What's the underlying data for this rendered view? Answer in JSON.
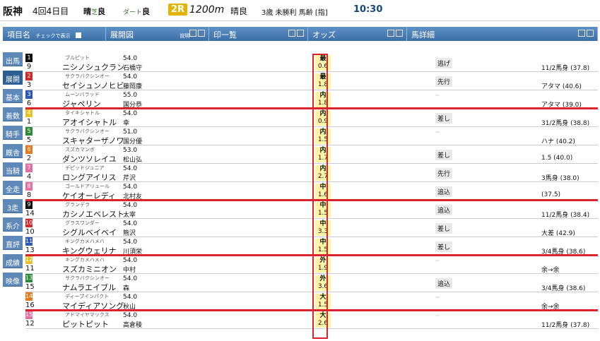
{
  "race": {
    "venue": "阪神",
    "meet": "4回4日目",
    "weather1_label": "晴",
    "weather1_turf": "芝",
    "weather1_cond": "良",
    "weather2_track": "ダート",
    "weather2_cond": "良",
    "race_no": "2R",
    "distance": "1200m",
    "weather3": "晴良",
    "conditions": "3歳 未勝利 馬齢 [指]",
    "time": "10:30"
  },
  "headers": {
    "items_label": "項目名",
    "items_check": "チェックで表示",
    "timeline": "展開図",
    "timeline_sub": "説明",
    "printlist": "印一覧",
    "odds": "オッズ",
    "horse_detail": "馬詳細"
  },
  "sidebar": {
    "items": [
      {
        "label": "出馬"
      },
      {
        "label": "展開"
      },
      {
        "label": "基本"
      },
      {
        "label": "着数"
      },
      {
        "label": "騎手"
      },
      {
        "label": "厩舎"
      },
      {
        "label": "当騎"
      },
      {
        "label": "全走"
      },
      {
        "label": "3走"
      },
      {
        "label": "系介"
      },
      {
        "label": "直評"
      },
      {
        "label": "成績"
      },
      {
        "label": "映像"
      }
    ]
  },
  "horses": [
    {
      "box": "1",
      "num": "9",
      "name": "ニシノシュクラン",
      "sire": "ブルピット",
      "weight": "54.0",
      "jockey": "石橋守",
      "odds": "0.6",
      "odds_label": "最",
      "pos": "逃げ",
      "margin": "11/2馬身 (37.8)"
    },
    {
      "box": "2",
      "num": "3",
      "name": "セイシュンノヒビ",
      "sire": "サクラバクシンオー",
      "weight": "54.0",
      "jockey": "藤岡康",
      "odds": "1.8",
      "odds_label": "最",
      "pos": "先行",
      "margin": "アタマ (40.6)"
    },
    {
      "box": "3",
      "num": "6",
      "name": "ジャペリン",
      "sire": "ムーンバラッド",
      "weight": "55.0",
      "jockey": "国分恭",
      "odds": "1.8",
      "odds_label": "内",
      "pos": "",
      "margin": "アタマ (39.0)"
    },
    {
      "box": "4",
      "num": "1",
      "name": "アオイシャトル",
      "sire": "タイキシャトル",
      "weight": "54.0",
      "jockey": "幸",
      "odds": "0.9",
      "odds_label": "内",
      "pos": "差し",
      "margin": "31/2馬身 (38.8)"
    },
    {
      "box": "5",
      "num": "5",
      "name": "スキャターザノワ",
      "sire": "サクラバクシンオー",
      "weight": "51.0",
      "jockey": "国分優",
      "odds": "1.5",
      "odds_label": "内",
      "pos": "",
      "margin": "ハナ (40.2)"
    },
    {
      "box": "6",
      "num": "2",
      "name": "ダンツソレイユ",
      "sire": "スズカマンボ",
      "weight": "53.0",
      "jockey": "松山弘",
      "odds": "1.7",
      "odds_label": "内",
      "pos": "差し",
      "margin": "1.5 (40.0)"
    },
    {
      "box": "7",
      "num": "4",
      "name": "ロングアイリス",
      "sire": "デピッドジュニア",
      "weight": "54.0",
      "jockey": "芹沢",
      "odds": "2.7",
      "odds_label": "内",
      "pos": "先行",
      "margin": "3馬身 (38.0)"
    },
    {
      "box": "8",
      "num": "8",
      "name": "ケイオーレディ",
      "sire": "ゴールドアリュール",
      "weight": "54.0",
      "jockey": "北村友",
      "odds": "1.6",
      "odds_label": "中",
      "pos": "追込",
      "margin": "(37.5)"
    },
    {
      "box": "9",
      "num": "14",
      "name": "カシノエベレスト",
      "sire": "グランデラ",
      "weight": "54.0",
      "jockey": "太宰",
      "odds": "1.5",
      "odds_label": "中",
      "pos": "追込",
      "margin": "11/2馬身 (38.4)"
    },
    {
      "box": "10",
      "num": "10",
      "name": "シグルベイベイ",
      "sire": "グラスワンダー",
      "weight": "54.0",
      "jockey": "熊沢",
      "odds": "3.3",
      "odds_label": "中",
      "pos": "差し",
      "margin": "大差 (42.9)"
    },
    {
      "box": "11",
      "num": "13",
      "name": "キングウェリナ",
      "sire": "キングカメハメハ",
      "weight": "54.0",
      "jockey": "川須栄",
      "odds": "1.5",
      "odds_label": "中",
      "pos": "差し",
      "margin": "3/4馬身 (38.6)"
    },
    {
      "box": "12",
      "num": "11",
      "name": "スズカミニオン",
      "sire": "キングカメハメハ",
      "weight": "54.0",
      "jockey": "中村",
      "odds": "1.9",
      "odds_label": "外",
      "pos": "",
      "margin": "余→余"
    },
    {
      "box": "13",
      "num": "15",
      "name": "ナムラエイブル",
      "sire": "サクラバクシンオー",
      "weight": "54.0",
      "jockey": "森",
      "odds": "3.6",
      "odds_label": "外",
      "pos": "追込",
      "margin": "3/4馬身 (38.6)"
    },
    {
      "box": "14",
      "num": "16",
      "name": "マイディアソング",
      "sire": "ディープインパクト",
      "weight": "54.0",
      "jockey": "秋山",
      "odds": "1.5",
      "odds_label": "大",
      "pos": "",
      "margin": "余→余"
    },
    {
      "box": "15",
      "num": "12",
      "name": "ピットピット",
      "sire": "アドマイヤマックス",
      "weight": "54.0",
      "jockey": "高倉稜",
      "odds": "2.6",
      "odds_label": "大",
      "pos": "",
      "margin": "11/2馬身 (37.8)"
    }
  ],
  "colors": {
    "accent": "#3c6fa7",
    "highlight": "#d9232d",
    "odds_bg": "#fff3a6",
    "race_badge": "#e2b400"
  }
}
